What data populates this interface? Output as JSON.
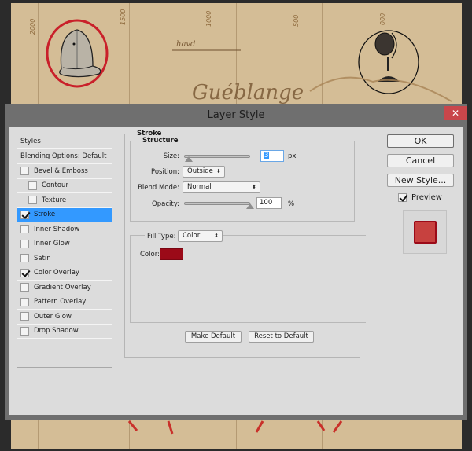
{
  "dialog": {
    "title": "Layer Style",
    "close_label": "✕"
  },
  "styles_list": {
    "header": "Styles",
    "blending_options": "Blending Options: Default",
    "items": [
      {
        "label": "Bevel & Emboss",
        "checked": false,
        "sub": false,
        "active": false
      },
      {
        "label": "Contour",
        "checked": false,
        "sub": true,
        "active": false
      },
      {
        "label": "Texture",
        "checked": false,
        "sub": true,
        "active": false
      },
      {
        "label": "Stroke",
        "checked": true,
        "sub": false,
        "active": true
      },
      {
        "label": "Inner Shadow",
        "checked": false,
        "sub": false,
        "active": false
      },
      {
        "label": "Inner Glow",
        "checked": false,
        "sub": false,
        "active": false
      },
      {
        "label": "Satin",
        "checked": false,
        "sub": false,
        "active": false
      },
      {
        "label": "Color Overlay",
        "checked": true,
        "sub": false,
        "active": false
      },
      {
        "label": "Gradient Overlay",
        "checked": false,
        "sub": false,
        "active": false
      },
      {
        "label": "Pattern Overlay",
        "checked": false,
        "sub": false,
        "active": false
      },
      {
        "label": "Outer Glow",
        "checked": false,
        "sub": false,
        "active": false
      },
      {
        "label": "Drop Shadow",
        "checked": false,
        "sub": false,
        "active": false
      }
    ]
  },
  "stroke": {
    "section_title": "Stroke",
    "structure_title": "Structure",
    "size_label": "Size:",
    "size_value": "3",
    "size_unit": "px",
    "size_slider_fraction": 0.03,
    "position_label": "Position:",
    "position_value": "Outside",
    "blend_mode_label": "Blend Mode:",
    "blend_mode_value": "Normal",
    "opacity_label": "Opacity:",
    "opacity_value": "100",
    "opacity_unit": "%",
    "opacity_slider_fraction": 1.0,
    "fill_type_label": "Fill Type:",
    "fill_type_value": "Color",
    "color_label": "Color:",
    "color_hex": "#9b0a18",
    "select_arrows": "⬍"
  },
  "footer_buttons": {
    "make_default": "Make Default",
    "reset_default": "Reset to Default"
  },
  "side_buttons": {
    "ok": "OK",
    "cancel": "Cancel",
    "new_style": "New Style...",
    "preview_label": "Preview",
    "preview_checked": true,
    "preview_color": "#c7413f"
  },
  "canvas_text": {
    "handwriting_1": "2000",
    "handwriting_2": "1500",
    "handwriting_3": "1000",
    "handwriting_4": "500",
    "handwriting_5": "000",
    "script_word": "Guéblange",
    "small_word": "havd"
  }
}
